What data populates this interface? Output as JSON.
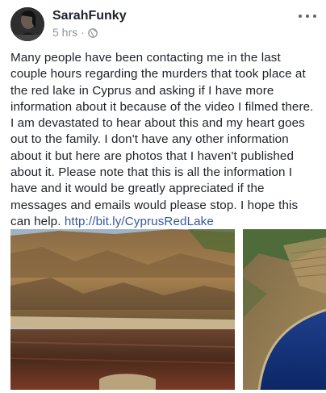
{
  "post": {
    "author": "SarahFunky",
    "time": "5 hrs",
    "separator": "·",
    "privacy_icon": "globe-icon",
    "more_icon": "more-options-icon",
    "body": "Many people have been contacting me in the last couple hours regarding the murders that took place at the red lake in Cyprus and asking if I have more information about it because of the video I filmed there. I am devastated to hear about this and my heart goes out to the family. I don't have any other information about it but here are photos that I haven't published about it. Please note that this is all the information I have and it would be greatly appreciated if the messages and emails would please stop. I hope this can help.",
    "link_text": "http://bit.ly/CyprusRedLake",
    "photos": [
      "red-lake-photo",
      "blue-lake-photo"
    ]
  },
  "colors": {
    "text": "#1d2129",
    "meta": "#90949c",
    "link": "#365899"
  }
}
